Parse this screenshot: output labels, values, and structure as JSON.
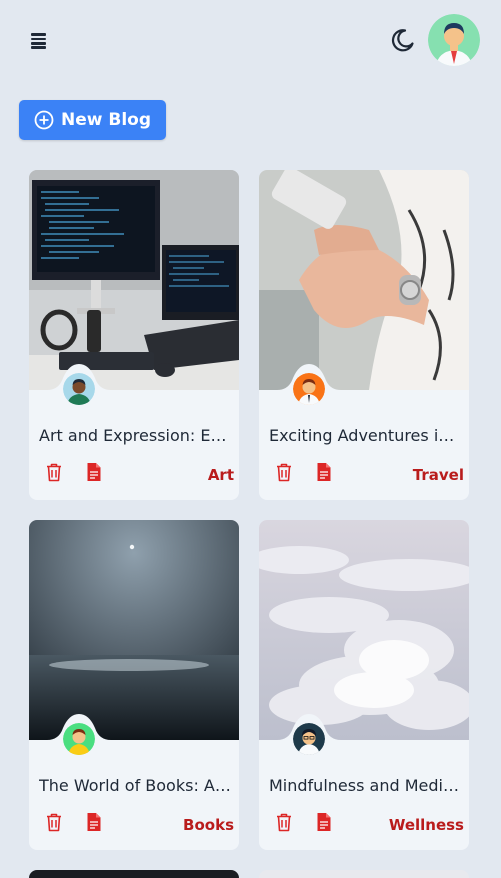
{
  "header": {
    "menu_icon": "hamburger-menu-icon",
    "theme_icon": "moon-icon",
    "avatar_icon": "user-avatar"
  },
  "toolbar": {
    "new_blog_label": "New Blog"
  },
  "colors": {
    "accent": "#3b82f6",
    "category": "#b91c1c",
    "background": "#e2e8f0",
    "card": "#f1f5f9"
  },
  "posts": [
    {
      "title": "Art and Expression: Exploring Creativity",
      "category": "Art"
    },
    {
      "title": "Exciting Adventures in Travel",
      "category": "Travel"
    },
    {
      "title": "The World of Books: A Journey",
      "category": "Books"
    },
    {
      "title": "Mindfulness and Meditation",
      "category": "Wellness"
    }
  ]
}
